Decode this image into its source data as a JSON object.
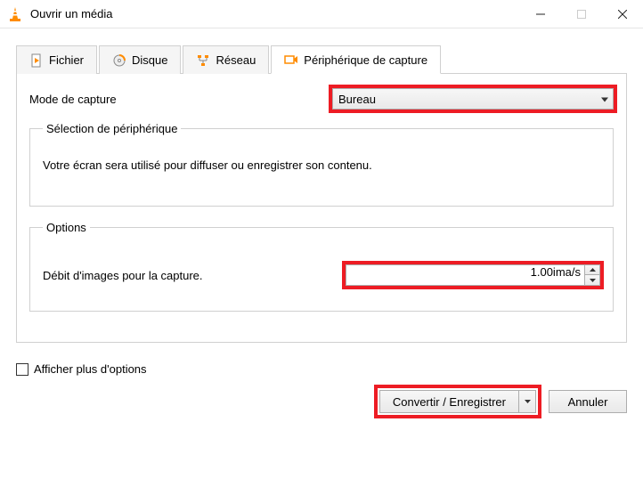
{
  "window": {
    "title": "Ouvrir un média"
  },
  "tabs": {
    "file": "Fichier",
    "disc": "Disque",
    "network": "Réseau",
    "capture": "Périphérique de capture"
  },
  "captureMode": {
    "label": "Mode de capture",
    "value": "Bureau"
  },
  "deviceSelection": {
    "legend": "Sélection de périphérique",
    "text": "Votre écran sera utilisé pour diffuser ou enregistrer son contenu."
  },
  "options": {
    "legend": "Options",
    "fpsLabel": "Débit d'images pour la capture.",
    "fpsValue": "1.00ima/s"
  },
  "footer": {
    "showMore": "Afficher plus d'options",
    "convert": "Convertir / Enregistrer",
    "cancel": "Annuler"
  }
}
